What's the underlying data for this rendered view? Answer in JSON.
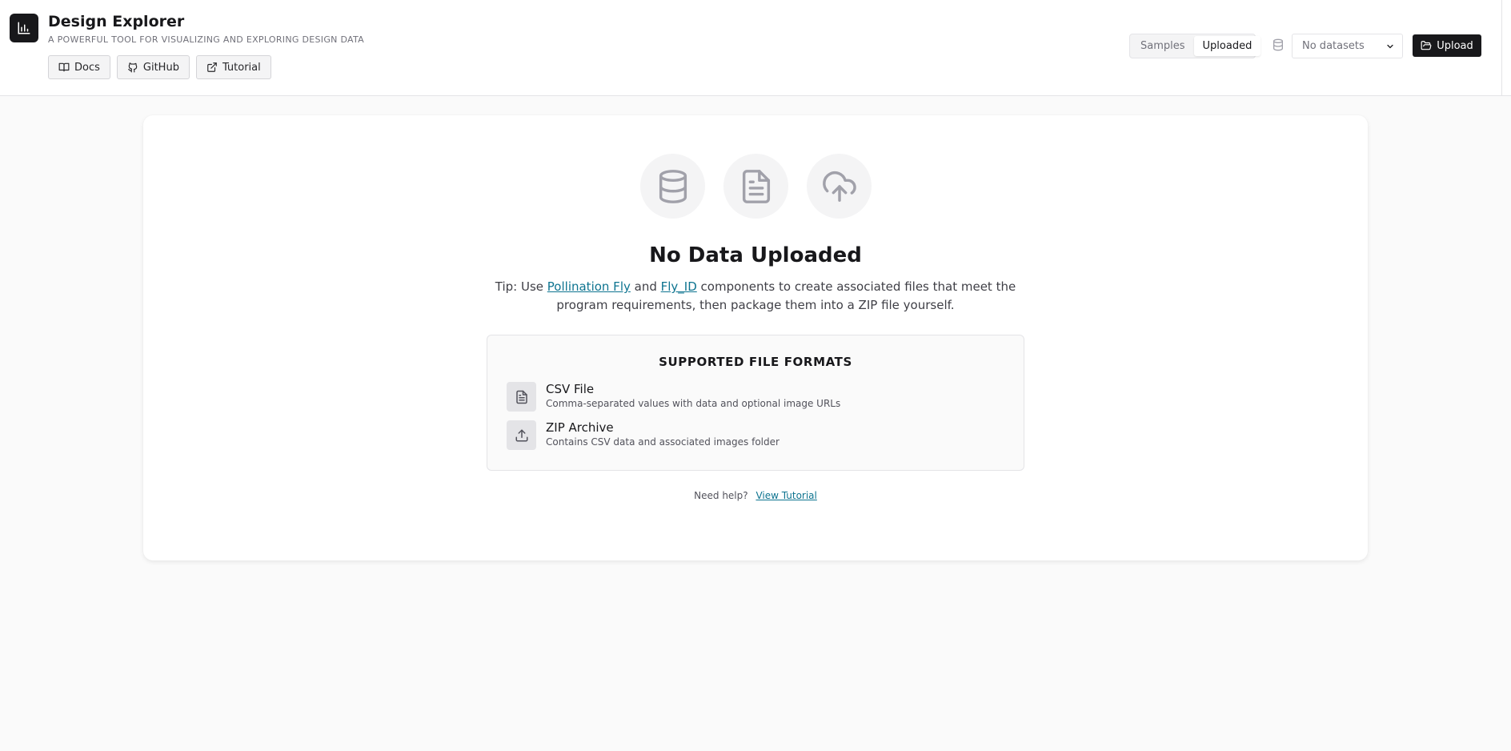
{
  "app": {
    "title": "Design Explorer",
    "subtitle": "A POWERFUL TOOL FOR VISUALIZING AND EXPLORING DESIGN DATA",
    "logo_icon": "bar-chart-icon"
  },
  "nav": {
    "docs": "Docs",
    "github": "GitHub",
    "tutorial": "Tutorial"
  },
  "toolbar": {
    "tab_samples": "Samples",
    "tab_uploaded": "Uploaded",
    "active_tab": "Uploaded",
    "dataset_select": "No datasets",
    "upload_label": "Upload"
  },
  "empty_state": {
    "icons": [
      "database-icon",
      "file-text-icon",
      "cloud-upload-icon"
    ],
    "heading": "No Data Uploaded",
    "tip_prefix": "Tip: Use ",
    "tip_link1": "Pollination Fly",
    "tip_and": " and ",
    "tip_link2": "Fly_ID",
    "tip_suffix": " components to create associated files that meet the program requirements, then package them into a ZIP file yourself."
  },
  "formats": {
    "title": "SUPPORTED FILE FORMATS",
    "items": [
      {
        "name": "CSV File",
        "desc": "Comma-separated values with data and optional image URLs",
        "icon": "file-text-icon"
      },
      {
        "name": "ZIP Archive",
        "desc": "Contains CSV data and associated images folder",
        "icon": "upload-icon"
      }
    ]
  },
  "help": {
    "text": "Need help?",
    "link": "View Tutorial"
  },
  "colors": {
    "background": "#fafafa",
    "primary": "#18181b",
    "link": "#0e7490"
  }
}
